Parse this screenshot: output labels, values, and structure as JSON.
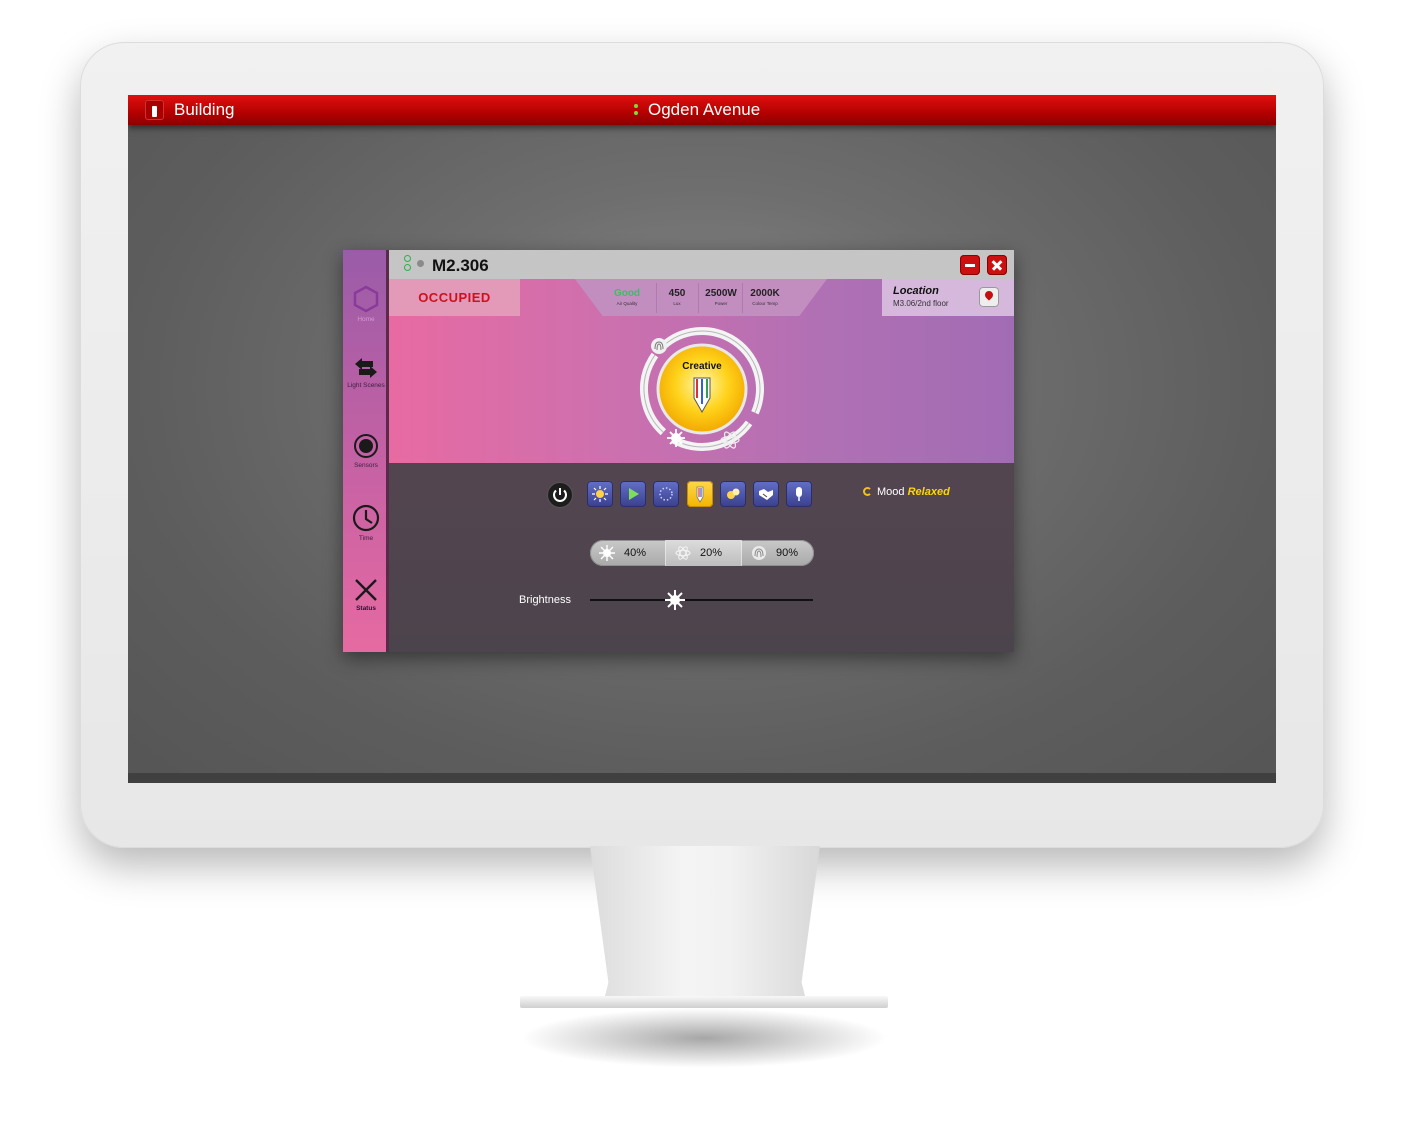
{
  "topbar": {
    "building_label": "Building",
    "address": "Ogden Avenue"
  },
  "window": {
    "room": "M2.306",
    "occupancy": "OCCUPIED",
    "stats": [
      {
        "value": "Good",
        "label": "Air Quality"
      },
      {
        "value": "450",
        "label": "Lux"
      },
      {
        "value": "2500W",
        "label": "Power"
      },
      {
        "value": "2000K",
        "label": "Colour Temp"
      }
    ],
    "location": {
      "title": "Location",
      "detail": "M3.06/2nd floor"
    },
    "dial": {
      "scene": "Creative"
    }
  },
  "sidebar": {
    "items": [
      {
        "label": "Home",
        "icon": "hexagon-icon"
      },
      {
        "label": "Light Scenes",
        "icon": "arrows-swap-icon"
      },
      {
        "label": "Sensors",
        "icon": "sensor-icon"
      },
      {
        "label": "Time",
        "icon": "clock-icon"
      },
      {
        "label": "Status",
        "icon": "close-x-icon"
      }
    ]
  },
  "controls": {
    "scenes": [
      "sun-icon",
      "play-icon",
      "dots-circle-icon",
      "pencil-icon",
      "dots-icon",
      "handshake-icon",
      "microphone-icon"
    ],
    "active_scene": "pencil-icon",
    "mood_label": "Mood",
    "mood_value": "Relaxed",
    "levels": [
      {
        "icon": "sun-burst-icon",
        "value": "40%"
      },
      {
        "icon": "atom-icon",
        "value": "20%"
      },
      {
        "icon": "fingerprint-icon",
        "value": "90%"
      }
    ],
    "brightness_label": "Brightness",
    "brightness_level": 0.38
  },
  "colors": {
    "brand_red": "#c80000",
    "accent_yellow": "#f5c400",
    "occupied_red": "#d0101c"
  }
}
